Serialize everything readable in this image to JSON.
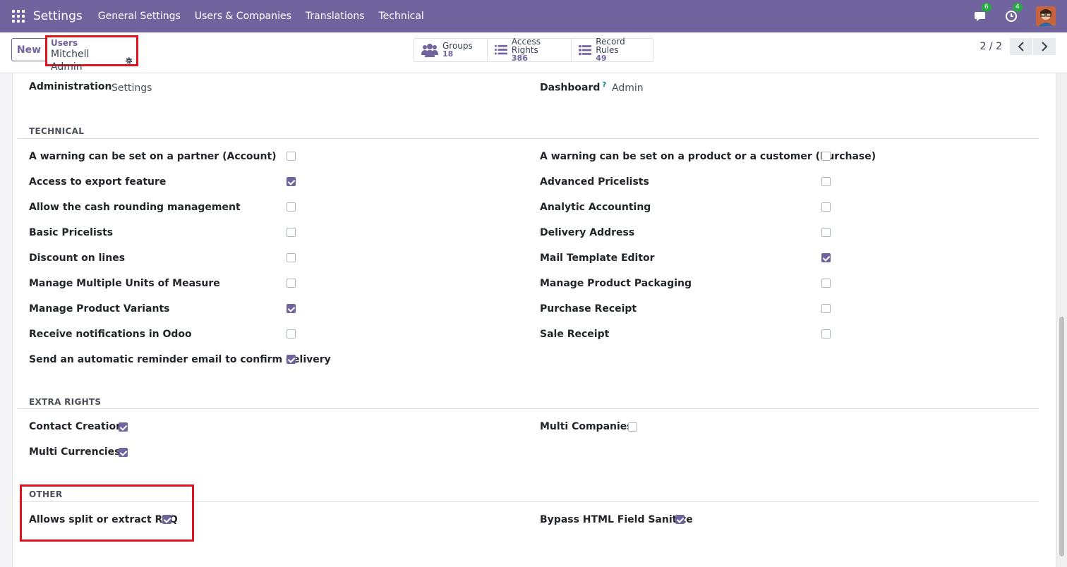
{
  "navbar": {
    "brand": "Settings",
    "menu": [
      "General Settings",
      "Users & Companies",
      "Translations",
      "Technical"
    ],
    "messages_count": "6",
    "activities_count": "4"
  },
  "control_panel": {
    "new_label": "New",
    "breadcrumb_parent": "Users",
    "breadcrumb_current": "Mitchell Admin",
    "smart_buttons": [
      {
        "label": "Groups",
        "value": "18",
        "icon": "users-icon"
      },
      {
        "label": "Access Rights",
        "value": "386",
        "icon": "list-icon"
      },
      {
        "label": "Record Rules",
        "value": "49",
        "icon": "list-icon"
      }
    ],
    "pager": "2 / 2"
  },
  "top_fields": {
    "administration_label": "Administration",
    "administration_value": "Settings",
    "dashboard_label": "Dashboard",
    "dashboard_help": "?",
    "dashboard_value": "Admin"
  },
  "technical": {
    "title": "TECHNICAL",
    "left": [
      {
        "label": "A warning can be set on a partner (Account)",
        "checked": false
      },
      {
        "label": "Access to export feature",
        "checked": true
      },
      {
        "label": "Allow the cash rounding management",
        "checked": false
      },
      {
        "label": "Basic Pricelists",
        "checked": false
      },
      {
        "label": "Discount on lines",
        "checked": false
      },
      {
        "label": "Manage Multiple Units of Measure",
        "checked": false
      },
      {
        "label": "Manage Product Variants",
        "checked": true
      },
      {
        "label": "Receive notifications in Odoo",
        "checked": false
      },
      {
        "label": "Send an automatic reminder email to confirm delivery",
        "checked": true
      }
    ],
    "right": [
      {
        "label": "A warning can be set on a product or a customer (Purchase)",
        "checked": false
      },
      {
        "label": "Advanced Pricelists",
        "checked": false
      },
      {
        "label": "Analytic Accounting",
        "checked": false
      },
      {
        "label": "Delivery Address",
        "checked": false
      },
      {
        "label": "Mail Template Editor",
        "checked": true
      },
      {
        "label": "Manage Product Packaging",
        "checked": false
      },
      {
        "label": "Purchase Receipt",
        "checked": false
      },
      {
        "label": "Sale Receipt",
        "checked": false
      }
    ]
  },
  "extra_rights": {
    "title": "EXTRA RIGHTS",
    "left": [
      {
        "label": "Contact Creation",
        "checked": true
      },
      {
        "label": "Multi Currencies",
        "checked": true
      }
    ],
    "right": [
      {
        "label": "Multi Companies",
        "checked": false
      }
    ]
  },
  "other": {
    "title": "OTHER",
    "left": [
      {
        "label": "Allows split or extract RFQ",
        "checked": true
      }
    ],
    "right": [
      {
        "label": "Bypass HTML Field Sanitize",
        "checked": true
      }
    ]
  }
}
